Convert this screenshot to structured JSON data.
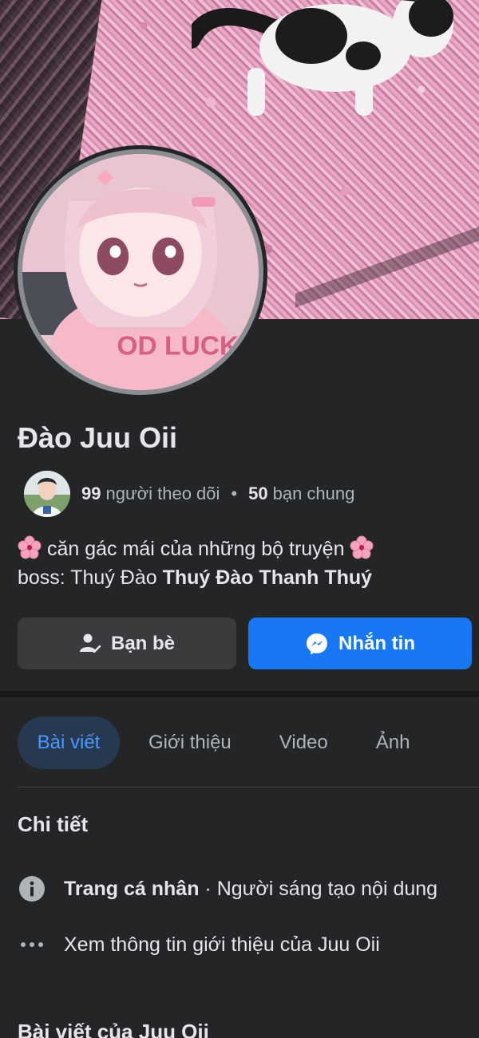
{
  "profile": {
    "name": "Đào Juu Oii",
    "followers_count": "99",
    "followers_label": "người theo dõi",
    "separator": "•",
    "mutual_count": "50",
    "mutual_label": "bạn chung",
    "bio_line1": "căn gác mái của những bộ truyện",
    "bio_line2_prefix": "boss: Thuý Đào",
    "bio_line2_bold": "Thuý Đào Thanh Thuý"
  },
  "actions": {
    "friends_label": "Bạn bè",
    "message_label": "Nhắn tin"
  },
  "tabs": [
    {
      "label": "Bài viết",
      "active": true
    },
    {
      "label": "Giới thiệu",
      "active": false
    },
    {
      "label": "Video",
      "active": false
    },
    {
      "label": "Ảnh",
      "active": false
    }
  ],
  "details": {
    "title": "Chi tiết",
    "page_type_bold": "Trang cá nhân",
    "page_type_rest": " · Người sáng tạo nội dung",
    "see_about": "Xem thông tin giới thiệu của Juu Oii"
  },
  "posts": {
    "title": "Bài viết của Juu Oii"
  },
  "colors": {
    "background": "#242526",
    "accent": "#1877f2",
    "active_tab_bg": "#263951",
    "active_tab_text": "#4599ff",
    "secondary_button": "#3a3b3c"
  },
  "icons": [
    "sakura-flower-icon",
    "friends-check-icon",
    "messenger-icon",
    "info-icon",
    "more-dots-icon"
  ]
}
